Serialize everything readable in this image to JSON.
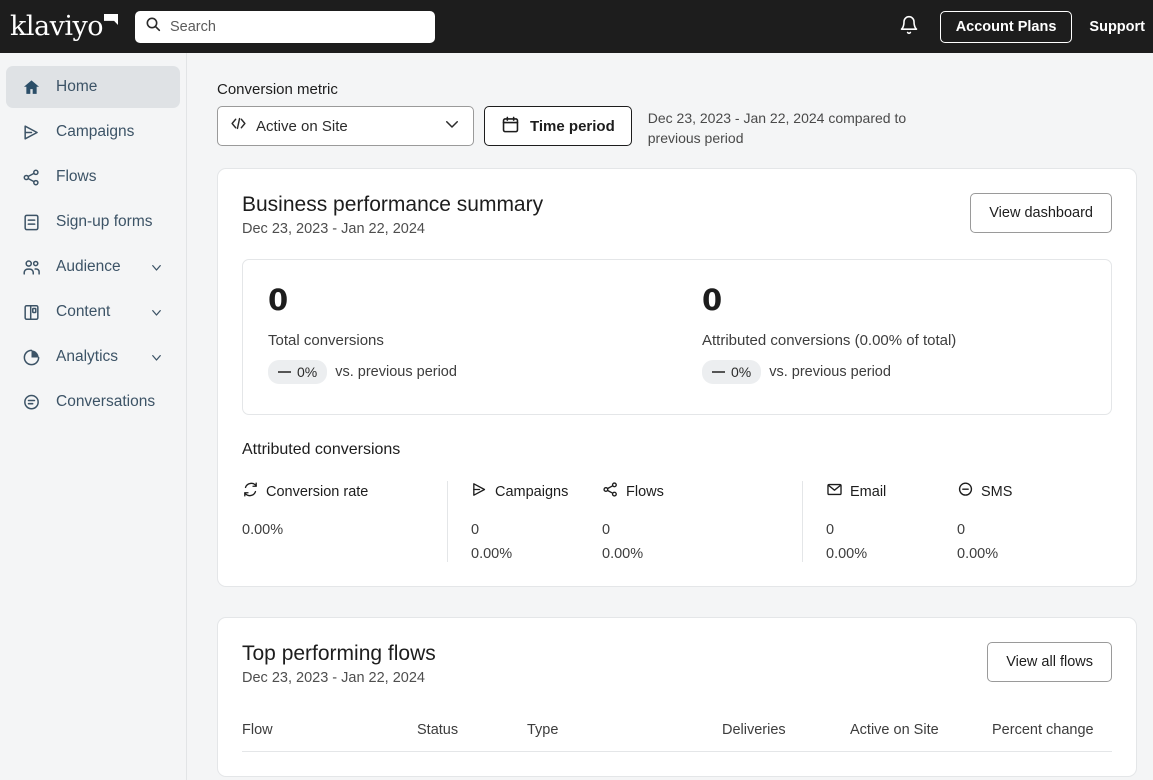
{
  "topbar": {
    "brand": "klaviyo",
    "search_placeholder": "Search",
    "account_plans": "Account Plans",
    "support": "Support"
  },
  "sidebar": {
    "items": [
      {
        "label": "Home",
        "icon": "home-icon",
        "active": true,
        "chevron": false
      },
      {
        "label": "Campaigns",
        "icon": "campaigns-icon",
        "active": false,
        "chevron": false
      },
      {
        "label": "Flows",
        "icon": "flows-icon",
        "active": false,
        "chevron": false
      },
      {
        "label": "Sign-up forms",
        "icon": "signup-forms-icon",
        "active": false,
        "chevron": false
      },
      {
        "label": "Audience",
        "icon": "audience-icon",
        "active": false,
        "chevron": true
      },
      {
        "label": "Content",
        "icon": "content-icon",
        "active": false,
        "chevron": true
      },
      {
        "label": "Analytics",
        "icon": "analytics-icon",
        "active": false,
        "chevron": true
      },
      {
        "label": "Conversations",
        "icon": "conversations-icon",
        "active": false,
        "chevron": false
      }
    ]
  },
  "controls": {
    "label": "Conversion metric",
    "metric_value": "Active on Site",
    "time_period_label": "Time period",
    "range_text": "Dec 23, 2023 - Jan 22, 2024 compared to previous period"
  },
  "summary_card": {
    "title": "Business performance summary",
    "subtitle": "Dec 23, 2023 - Jan 22, 2024",
    "action_label": "View dashboard",
    "stats": [
      {
        "value": "0",
        "label": "Total conversions",
        "delta": "0%",
        "delta_note": "vs. previous period"
      },
      {
        "value": "0",
        "label": "Attributed conversions (0.00% of total)",
        "delta": "0%",
        "delta_note": "vs. previous period"
      }
    ],
    "attributed_title": "Attributed conversions",
    "attributed": [
      {
        "label": "Conversion rate",
        "icon": "conversion-rate-icon",
        "value1": "0.00%",
        "value2": ""
      },
      {
        "label": "Campaigns",
        "icon": "campaigns-icon",
        "value1": "0",
        "value2": "0.00%"
      },
      {
        "label": "Flows",
        "icon": "flows-icon",
        "value1": "0",
        "value2": "0.00%"
      },
      {
        "label": "Email",
        "icon": "email-icon",
        "value1": "0",
        "value2": "0.00%"
      },
      {
        "label": "SMS",
        "icon": "sms-icon",
        "value1": "0",
        "value2": "0.00%"
      }
    ]
  },
  "flows_card": {
    "title": "Top performing flows",
    "subtitle": "Dec 23, 2023 - Jan 22, 2024",
    "action_label": "View all flows",
    "columns": [
      "Flow",
      "Status",
      "Type",
      "Deliveries",
      "Active on Site",
      "Percent change"
    ]
  },
  "colors": {
    "topbar_bg": "#1d1d1d",
    "page_bg": "#f4f5f6",
    "sidebar_text": "#3c5366",
    "sidebar_active_bg": "#dfe2e5",
    "card_bg": "#ffffff",
    "card_border": "#e4e6e8"
  }
}
